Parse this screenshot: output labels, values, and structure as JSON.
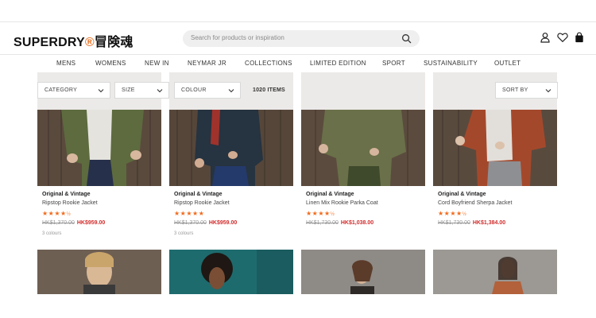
{
  "header": {
    "logo_text": "SUPERDRY",
    "logo_mark": "®",
    "logo_jp": "冒険魂",
    "search_placeholder": "Search for products or inspiration"
  },
  "nav": {
    "items": [
      "MENS",
      "WOMENS",
      "NEW IN",
      "NEYMAR JR",
      "COLLECTIONS",
      "LIMITED EDITION",
      "SPORT",
      "SUSTAINABILITY",
      "OUTLET"
    ]
  },
  "filters": {
    "category": "CATEGORY",
    "size": "SIZE",
    "colour": "COLOUR",
    "items_count": "1020 ITEMS",
    "sort": "SORT BY"
  },
  "products": [
    {
      "brand": "Original & Vintage",
      "name": "Ripstop Rookie Jacket",
      "stars": "★★★★",
      "half": "½",
      "old_price": "HK$1,370.00",
      "new_price": "HK$959.00",
      "colours": "3 colours"
    },
    {
      "brand": "Original & Vintage",
      "name": "Ripstop Rookie Jacket",
      "stars": "★★★★★",
      "half": "",
      "old_price": "HK$1,370.00",
      "new_price": "HK$959.00",
      "colours": "3 colours"
    },
    {
      "brand": "Original & Vintage",
      "name": "Linen Mix Rookie Parka Coat",
      "stars": "★★★★",
      "half": "½",
      "old_price": "HK$1,730.00",
      "new_price": "HK$1,038.00",
      "colours": ""
    },
    {
      "brand": "Original & Vintage",
      "name": "Cord Boyfriend Sherpa Jacket",
      "stars": "★★★★",
      "half": "½",
      "old_price": "HK$1,730.00",
      "new_price": "HK$1,384.00",
      "colours": ""
    }
  ],
  "colors": {
    "accent": "#f26b1d",
    "sale": "#d12c2c"
  }
}
